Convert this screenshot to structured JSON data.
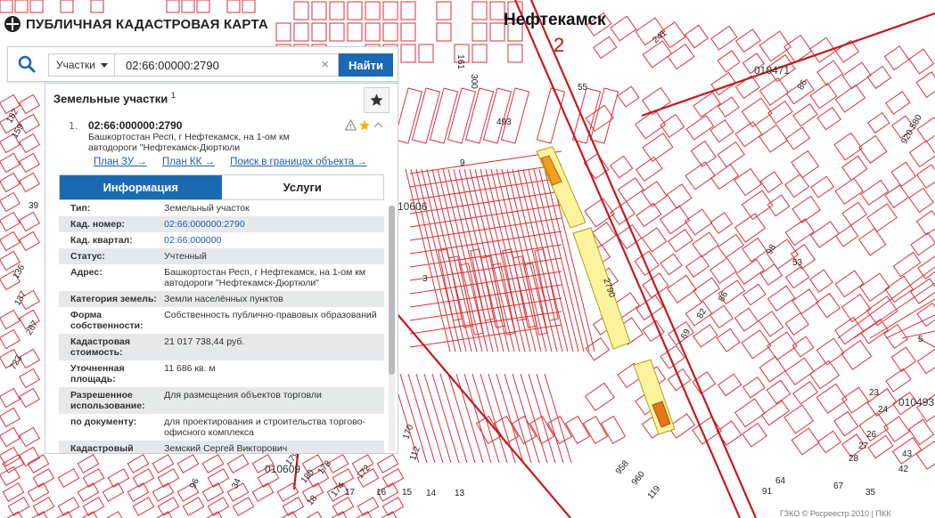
{
  "header": {
    "title": "ПУБЛИЧНАЯ КАДАСТРОВАЯ КАРТА"
  },
  "search": {
    "type_label": "Участки",
    "query": "02:66:00000:2790",
    "clear_icon": "×",
    "find_label": "Найти"
  },
  "panel": {
    "title": "Земельные участки",
    "title_count": "1",
    "result": {
      "index": "1.",
      "cad_number": "02:66:000000:2790",
      "address": "Башкортостан Респ, г Нефтекамск, на 1-ом км автодороги \"Нефтекамск-Дюртюли",
      "links": [
        "План ЗУ →",
        "План КК →",
        "Поиск в границах объекта →"
      ]
    },
    "tabs": [
      "Информация",
      "Услуги"
    ],
    "properties": [
      {
        "key": "Тип:",
        "value": "Земельный участок"
      },
      {
        "key": "Кад. номер:",
        "value": "02:66:000000:2790",
        "link": true
      },
      {
        "key": "Кад. квартал:",
        "value": "02:66:000000",
        "link": true
      },
      {
        "key": "Статус:",
        "value": "Учтенный"
      },
      {
        "key": "Адрес:",
        "value": "Башкортостан Респ, г Нефтекамск, на 1-ом км автодороги \"Нефтекамск-Дюртюли\""
      },
      {
        "key": "Категория земель:",
        "value": "Земли населённых пунктов"
      },
      {
        "key": "Форма собственности:",
        "value": "Собственность публично-правовых образований"
      },
      {
        "key": "Кадастровая стоимость:",
        "value": "21 017 738,44 руб."
      },
      {
        "key": "Уточненная площадь:",
        "value": "11 686 кв. м"
      },
      {
        "key": "Разрешенное использование:",
        "value": "Для размещения объектов торговли"
      },
      {
        "key": "по документу:",
        "value": "для проектирования и строительства торгово-офисного комплекса"
      },
      {
        "key": "Кадастровый",
        "value": "Земский Сергей Викторович"
      }
    ]
  },
  "map": {
    "city": "Нефтекамск",
    "city_num": "2",
    "parcel_label": "2790",
    "blocks": [
      "010471",
      "10606",
      "010609",
      "010493"
    ],
    "numbers": [
      "55",
      "241",
      "86",
      "9",
      "493",
      "161",
      "300",
      "39",
      "182",
      "159",
      "3",
      "53",
      "98",
      "86",
      "82",
      "69",
      "18",
      "17",
      "16",
      "15",
      "14",
      "13",
      "958",
      "960",
      "119",
      "64",
      "91",
      "23",
      "24",
      "26",
      "27",
      "28",
      "35",
      "42",
      "43",
      "67",
      "136",
      "137",
      "267",
      "723",
      "34",
      "96",
      "179",
      "180",
      "174",
      "178",
      "172",
      "170",
      "112",
      "5",
      "920 580"
    ]
  },
  "attribution": "ГЗКО © Росреестр 2010 | ПКК"
}
